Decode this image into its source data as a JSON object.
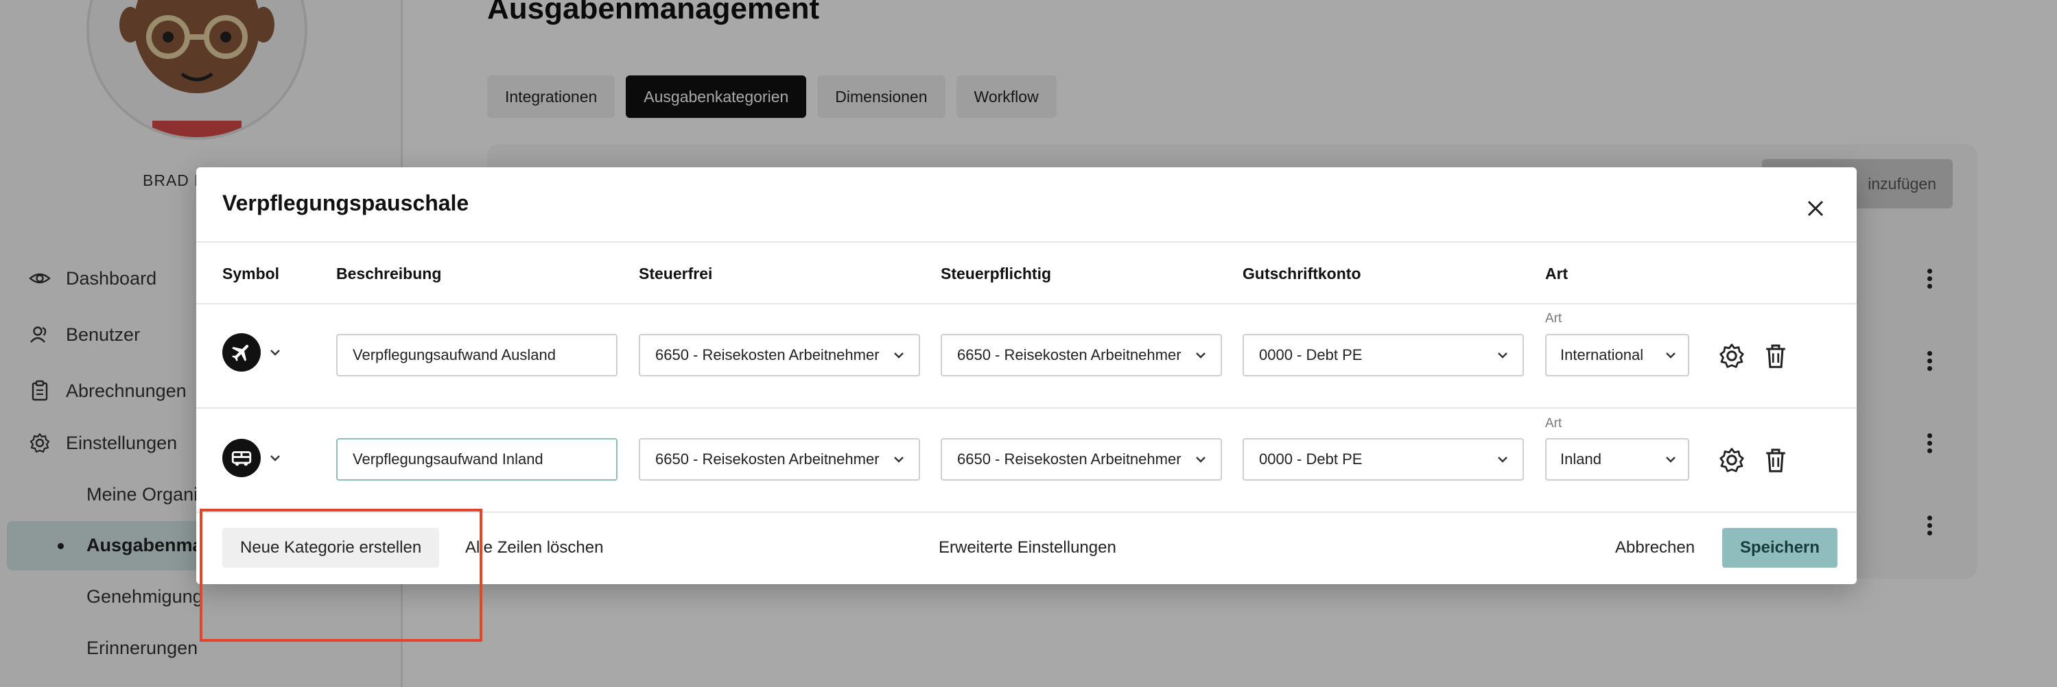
{
  "sidebar": {
    "user_name": "BRAD B",
    "nav": [
      {
        "label": "Dashboard",
        "icon": "eye-icon"
      },
      {
        "label": "Benutzer",
        "icon": "users-icon"
      },
      {
        "label": "Abrechnungen",
        "icon": "clipboard-icon"
      },
      {
        "label": "Einstellungen",
        "icon": "gear-icon"
      }
    ],
    "sub": [
      "Meine Organi",
      "Ausgabenma",
      "Genehmigung",
      "Erinnerungen"
    ]
  },
  "page": {
    "title": "Ausgabenmanagement",
    "tabs": [
      "Integrationen",
      "Ausgabenkategorien",
      "Dimensionen",
      "Workflow"
    ],
    "active_tab": "Ausgabenkategorien",
    "add_button": "inzufügen"
  },
  "modal": {
    "title": "Verpflegungspauschale",
    "columns": [
      "Symbol",
      "Beschreibung",
      "Steuerfrei",
      "Steuerpflichtig",
      "Gutschriftkonto",
      "Art"
    ],
    "rows": [
      {
        "symbol": "airplane-icon",
        "description": "Verpflegungsaufwand Ausland",
        "steuerfrei": "6650 - Reisekosten Arbeitnehmer",
        "steuerpflichtig": "6650 - Reisekosten Arbeitnehmer",
        "gutschriftkonto": "0000 - Debt PE",
        "art_label": "Art",
        "art": "International"
      },
      {
        "symbol": "bus-icon",
        "description": "Verpflegungsaufwand Inland",
        "steuerfrei": "6650 - Reisekosten Arbeitnehmer",
        "steuerpflichtig": "6650 - Reisekosten Arbeitnehmer",
        "gutschriftkonto": "0000 - Debt PE",
        "art_label": "Art",
        "art": "Inland"
      }
    ],
    "footer": {
      "new_category": "Neue Kategorie erstellen",
      "delete_all": "Alle Zeilen löschen",
      "advanced": "Erweiterte Einstellungen",
      "cancel": "Abbrechen",
      "save": "Speichern"
    }
  },
  "colors": {
    "accent": "#8fbcbc",
    "highlight": "#e2452f",
    "active_tab": "#111111"
  }
}
